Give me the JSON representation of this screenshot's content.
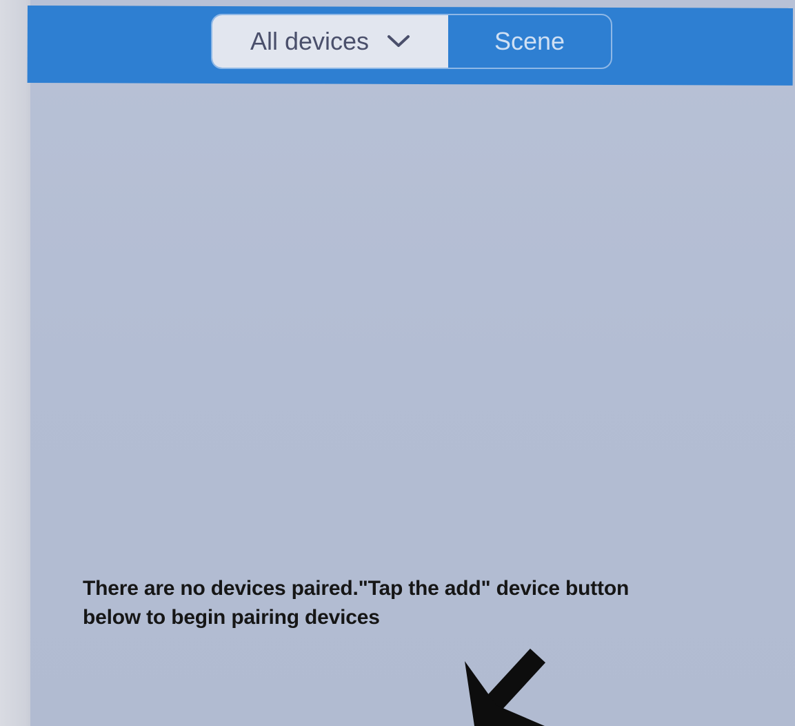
{
  "header": {
    "filter_dropdown_label": "All devices",
    "scene_tab_label": "Scene"
  },
  "empty_state": {
    "message_line1": "There are no devices paired.\"Tap the add\" device button",
    "message_line2": "below to begin pairing devices"
  },
  "icons": {
    "dropdown": "chevron-down-icon",
    "pointer": "arrow-down-left-icon"
  },
  "colors": {
    "header_blue": "#2e7fd2",
    "background": "#b4bed4",
    "text": "#161616"
  }
}
